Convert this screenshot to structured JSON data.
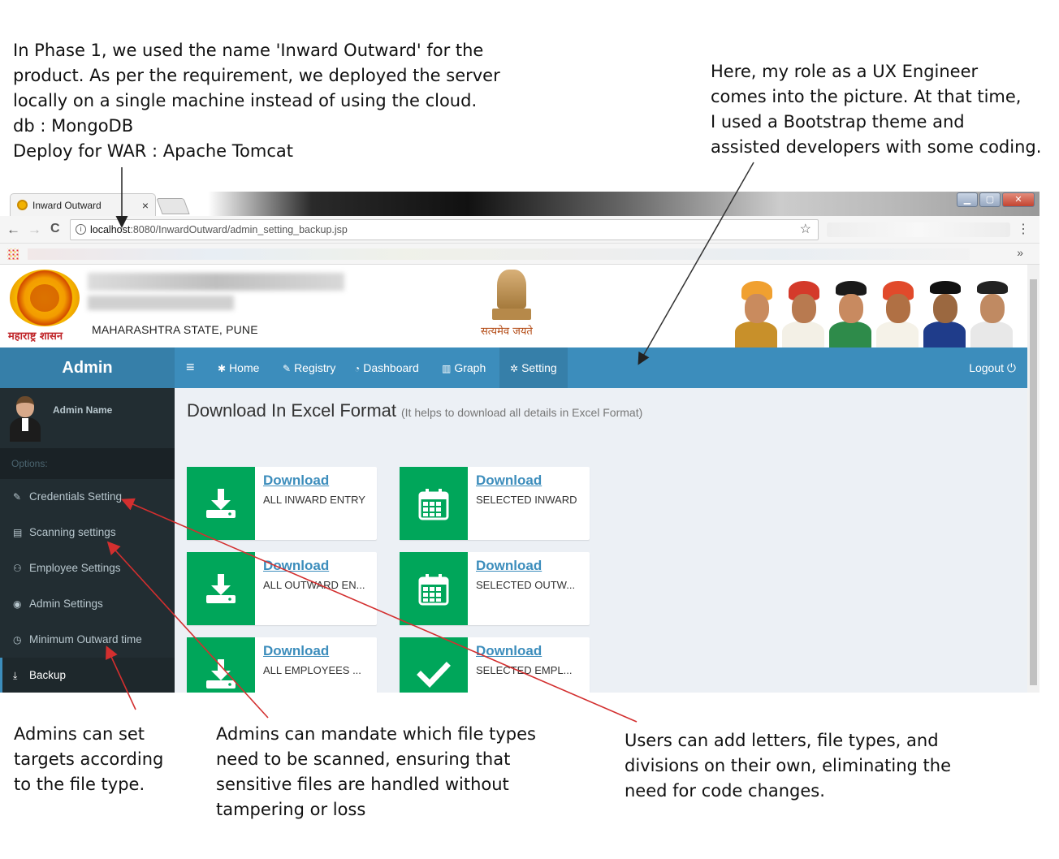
{
  "annotations": {
    "top_left": "In Phase 1, we used the name 'Inward Outward' for the\nproduct. As per the requirement, we deployed the server\nlocally on a single machine instead of using the cloud.\ndb : MongoDB\nDeploy for WAR : Apache Tomcat",
    "top_right": "Here, my role as a UX Engineer\ncomes into the picture. At that time,\nI used a Bootstrap theme and\nassisted developers with some coding.",
    "bottom_1": "Admins can set\ntargets according\nto the file type.",
    "bottom_2": "Admins can mandate which file types\nneed to be scanned, ensuring that\nsensitive files are handled without\ntampering or loss",
    "bottom_3": "Users can add letters, file types, and\ndivisions on their own, eliminating the\nneed for code changes."
  },
  "browser": {
    "tab_title": "Inward Outward",
    "tab_close": "×",
    "url_host": "localhost",
    "url_rest": ":8080/InwardOutward/admin_setting_backup.jsp",
    "back": "←",
    "forward": "→",
    "reload": "C",
    "star": "☆",
    "menu": "⋮",
    "bookmarks_more": "»"
  },
  "header": {
    "state_logo_text": "महाराष्ट्र शासन",
    "department": "MAHARASHTRA STATE, PUNE",
    "emblem_text": "सत्यमेव जयते"
  },
  "navbar": {
    "brand": "Admin",
    "menu_icon": "≡",
    "items": [
      {
        "icon": "✱",
        "label": "Home"
      },
      {
        "icon": "✎",
        "label": "Registry"
      },
      {
        "icon": "◔",
        "label": "Dashboard"
      },
      {
        "icon": "▥",
        "label": "Graph"
      },
      {
        "icon": "✲",
        "label": "Setting"
      }
    ],
    "logout": "Logout ⏻"
  },
  "sidebar": {
    "user_name": "Admin Name",
    "options_header": "Options:",
    "items": [
      {
        "icon": "✎",
        "label": "Credentials Setting"
      },
      {
        "icon": "▤",
        "label": "Scanning settings"
      },
      {
        "icon": "⚇",
        "label": "Employee Settings"
      },
      {
        "icon": "◉",
        "label": "Admin Settings"
      },
      {
        "icon": "◷",
        "label": "Minimum Outward time"
      },
      {
        "icon": "⤓",
        "label": "Backup"
      }
    ],
    "active_index": 5
  },
  "content": {
    "title": "Download In Excel Format",
    "subtitle": "(It helps to download all details in Excel Format)",
    "boxes": [
      {
        "link": "Download",
        "sub": "ALL INWARD ENTRY",
        "icon": "download-icon"
      },
      {
        "link": "Download",
        "sub": "SELECTED INWARD",
        "icon": "calendar-icon"
      },
      {
        "link": "Download",
        "sub": "ALL OUTWARD EN...",
        "icon": "download-icon"
      },
      {
        "link": "Download",
        "sub": "SELECTED OUTW...",
        "icon": "calendar-icon"
      },
      {
        "link": "Download",
        "sub": "ALL EMPLOYEES ...",
        "icon": "download-icon"
      },
      {
        "link": "Download",
        "sub": "SELECTED EMPL...",
        "icon": "check-icon"
      }
    ]
  },
  "colors": {
    "navbar": "#3c8dbc",
    "sidebar": "#222d32",
    "success": "#00a65a",
    "arrow_red": "#d32f2f",
    "arrow_dark": "#333333"
  }
}
